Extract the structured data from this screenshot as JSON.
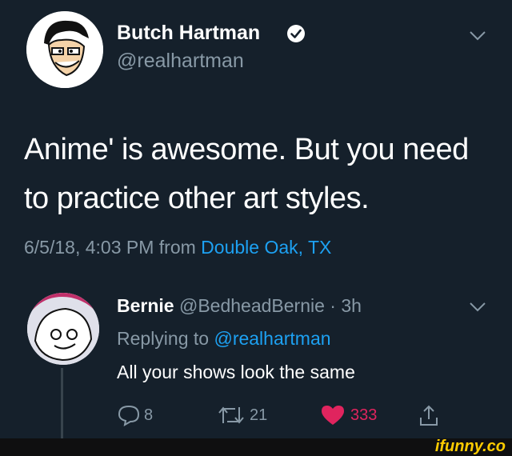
{
  "tweet": {
    "author_name": "Butch Hartman",
    "handle": "@realhartman",
    "text_line1": "Anime' is awesome. But you need",
    "text_line2": "to practice other art styles.",
    "meta_date": "6/5/18, 4:03 PM from",
    "location": "Double Oak, TX"
  },
  "reply": {
    "author_name": "Bernie",
    "handle_time": "@BedheadBernie · 3h",
    "replying_prefix": "Replying to",
    "replying_handle": "@realhartman",
    "text": "All your shows look the same",
    "actions": {
      "reply_count": "8",
      "retweet_count": "21",
      "like_count": "333"
    }
  },
  "watermark": {
    "label": "ifunny.co"
  },
  "colors": {
    "background": "#15202b",
    "link": "#1da1f2",
    "like": "#e0245e",
    "muted": "#8899a6"
  }
}
